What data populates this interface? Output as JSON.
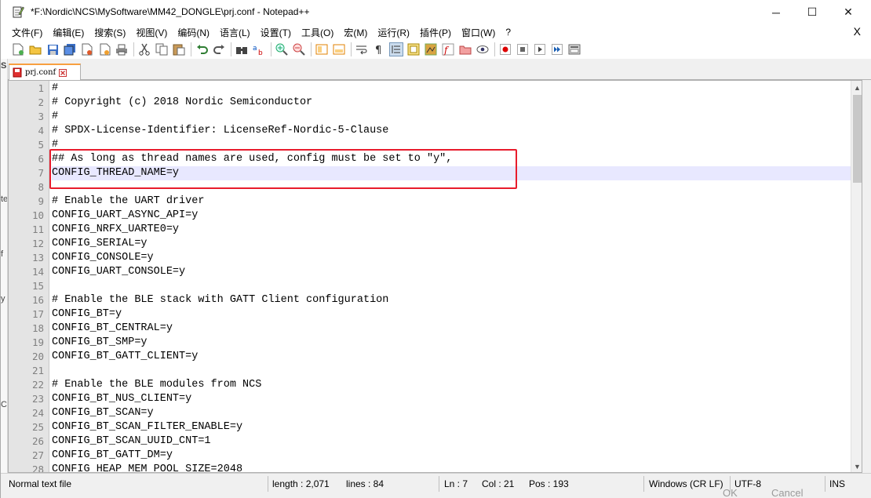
{
  "window": {
    "title": "*F:\\Nordic\\NCS\\MySoftware\\MM42_DONGLE\\prj.conf - Notepad++",
    "minimize_glyph": "─",
    "maximize_glyph": "☐",
    "close_glyph": "✕"
  },
  "menu": {
    "items": [
      "文件(F)",
      "编辑(E)",
      "搜索(S)",
      "视图(V)",
      "编码(N)",
      "语言(L)",
      "设置(T)",
      "工具(O)",
      "宏(M)",
      "运行(R)",
      "插件(P)",
      "窗口(W)",
      "?"
    ],
    "close_glyph": "X"
  },
  "tab": {
    "label": "prj.conf"
  },
  "editor": {
    "cursor_line": 7,
    "line_numbers": [
      "1",
      "2",
      "3",
      "4",
      "5",
      "6",
      "7",
      "8",
      "9",
      "10",
      "11",
      "12",
      "13",
      "14",
      "15",
      "16",
      "17",
      "18",
      "19",
      "20",
      "21",
      "22",
      "23",
      "24",
      "25",
      "26",
      "27",
      "28"
    ],
    "lines": [
      "#",
      "# Copyright (c) 2018 Nordic Semiconductor",
      "#",
      "# SPDX-License-Identifier: LicenseRef-Nordic-5-Clause",
      "#",
      "## As long as thread names are used, config must be set to \"y\",",
      "CONFIG_THREAD_NAME=y",
      "",
      "# Enable the UART driver",
      "CONFIG_UART_ASYNC_API=y",
      "CONFIG_NRFX_UARTE0=y",
      "CONFIG_SERIAL=y",
      "CONFIG_CONSOLE=y",
      "CONFIG_UART_CONSOLE=y",
      "",
      "# Enable the BLE stack with GATT Client configuration",
      "CONFIG_BT=y",
      "CONFIG_BT_CENTRAL=y",
      "CONFIG_BT_SMP=y",
      "CONFIG_BT_GATT_CLIENT=y",
      "",
      "# Enable the BLE modules from NCS",
      "CONFIG_BT_NUS_CLIENT=y",
      "CONFIG_BT_SCAN=y",
      "CONFIG_BT_SCAN_FILTER_ENABLE=y",
      "CONFIG_BT_SCAN_UUID_CNT=1",
      "CONFIG_BT_GATT_DM=y",
      "CONFIG_HEAP_MEM_POOL_SIZE=2048"
    ]
  },
  "status": {
    "file_type": "Normal text file",
    "length": "length : 2,071",
    "lines": "lines : 84",
    "ln": "Ln : 7",
    "col": "Col : 21",
    "pos": "Pos : 193",
    "eol": "Windows (CR LF)",
    "encoding": "UTF-8",
    "mode": "INS"
  },
  "background": {
    "ok_label": "OK",
    "cancel_label": "Cancel",
    "strip_chars": [
      "S",
      "te",
      "f",
      "y",
      "C"
    ]
  },
  "colors": {
    "highlight_box": "#e81c2c",
    "current_line": "#e8e8ff",
    "gutter": "#e4e4e4",
    "tab_accent": "#f8a040"
  }
}
